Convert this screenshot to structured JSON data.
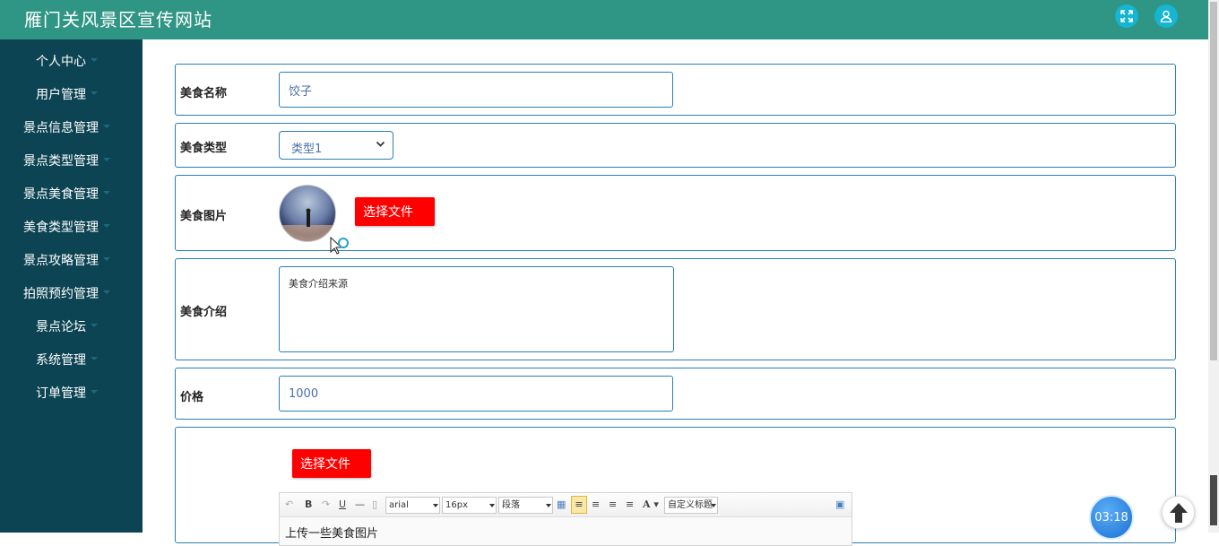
{
  "header": {
    "title": "雁门关风景区宣传网站",
    "icons": [
      "fullscreen-icon",
      "user-icon"
    ]
  },
  "sidebar": {
    "items": [
      {
        "label": "个人中心"
      },
      {
        "label": "用户管理"
      },
      {
        "label": "景点信息管理"
      },
      {
        "label": "景点类型管理"
      },
      {
        "label": "景点美食管理"
      },
      {
        "label": "美食类型管理"
      },
      {
        "label": "景点攻略管理"
      },
      {
        "label": "拍照预约管理"
      },
      {
        "label": "景点论坛"
      },
      {
        "label": "系统管理"
      },
      {
        "label": "订单管理"
      }
    ]
  },
  "form": {
    "name": {
      "label": "美食名称",
      "value": "饺子"
    },
    "type": {
      "label": "美食类型",
      "selected": "类型1"
    },
    "image": {
      "label": "美食图片",
      "button": "选择文件"
    },
    "intro": {
      "label": "美食介绍",
      "value": "美食介绍来源"
    },
    "price": {
      "label": "价格",
      "value": "1000"
    },
    "detail": {
      "button": "选择文件",
      "toolbar": {
        "font": "arial",
        "size": "16px",
        "paragraph": "段落",
        "custom_title": "自定义标题"
      },
      "content": "上传一些美食图片"
    }
  },
  "widgets": {
    "timer": "03:18"
  },
  "colors": {
    "header": "#2f9584",
    "sidebar": "#0d4453",
    "accent_border": "#2a7fb5",
    "button_red": "#ff0000"
  }
}
